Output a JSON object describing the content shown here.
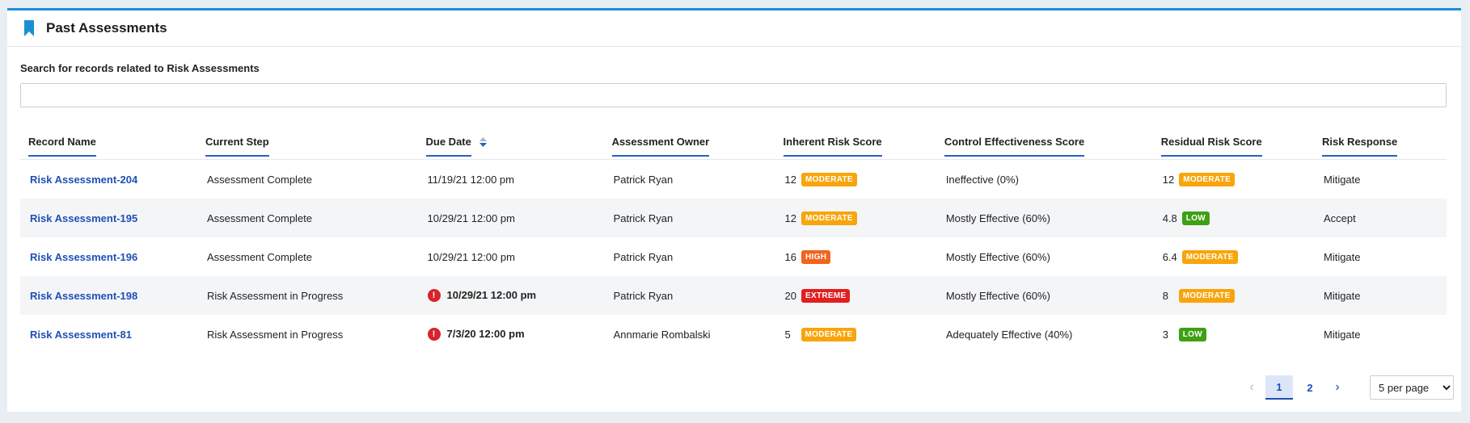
{
  "header": {
    "title": "Past Assessments",
    "icon": "bookmark-icon",
    "accent_color": "#1a8fd6"
  },
  "search": {
    "label": "Search for records related to Risk Assessments",
    "value": "",
    "placeholder": ""
  },
  "table": {
    "columns": [
      "Record Name",
      "Current Step",
      "Due Date",
      "Assessment Owner",
      "Inherent Risk Score",
      "Control Effectiveness Score",
      "Residual Risk Score",
      "Risk Response"
    ],
    "sorted_column": "Due Date",
    "rows": [
      {
        "record": "Risk Assessment-204",
        "step": "Assessment Complete",
        "due": "11/19/21 12:00 pm",
        "overdue": false,
        "owner": "Patrick Ryan",
        "inherent_score": "12",
        "inherent_level": "MODERATE",
        "control": "Ineffective (0%)",
        "residual_score": "12",
        "residual_level": "MODERATE",
        "response": "Mitigate"
      },
      {
        "record": "Risk Assessment-195",
        "step": "Assessment Complete",
        "due": "10/29/21 12:00 pm",
        "overdue": false,
        "owner": "Patrick Ryan",
        "inherent_score": "12",
        "inherent_level": "MODERATE",
        "control": "Mostly Effective (60%)",
        "residual_score": "4.8",
        "residual_level": "LOW",
        "response": "Accept"
      },
      {
        "record": "Risk Assessment-196",
        "step": "Assessment Complete",
        "due": "10/29/21 12:00 pm",
        "overdue": false,
        "owner": "Patrick Ryan",
        "inherent_score": "16",
        "inherent_level": "HIGH",
        "control": "Mostly Effective (60%)",
        "residual_score": "6.4",
        "residual_level": "MODERATE",
        "response": "Mitigate"
      },
      {
        "record": "Risk Assessment-198",
        "step": "Risk Assessment in Progress",
        "due": "10/29/21 12:00 pm",
        "overdue": true,
        "owner": "Patrick Ryan",
        "inherent_score": "20",
        "inherent_level": "EXTREME",
        "control": "Mostly Effective (60%)",
        "residual_score": "8",
        "residual_level": "MODERATE",
        "response": "Mitigate"
      },
      {
        "record": "Risk Assessment-81",
        "step": "Risk Assessment in Progress",
        "due": "7/3/20 12:00 pm",
        "overdue": true,
        "owner": "Annmarie Rombalski",
        "inherent_score": "5",
        "inherent_level": "MODERATE",
        "control": "Adequately Effective (40%)",
        "residual_score": "3",
        "residual_level": "LOW",
        "response": "Mitigate"
      }
    ]
  },
  "level_colors": {
    "LOW": "#3ea014",
    "MODERATE": "#f8a50c",
    "HIGH": "#f2651c",
    "EXTREME": "#e21f1f"
  },
  "pagination": {
    "pages": [
      "1",
      "2"
    ],
    "current": "1",
    "per_page": "5 per page",
    "per_page_options": [
      "5 per page"
    ]
  }
}
